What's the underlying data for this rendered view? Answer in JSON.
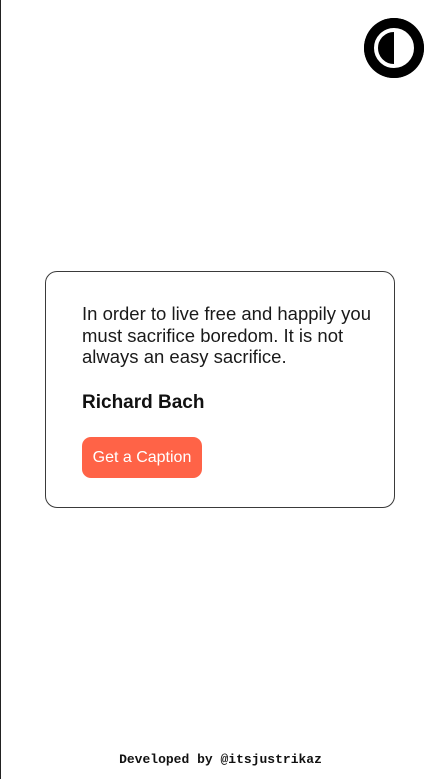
{
  "theme_toggle": {
    "icon": "contrast-icon",
    "color": "#000000"
  },
  "quote_card": {
    "text": "In order to live free and happily you must sacrifice boredom. It is not always an easy sacrifice.",
    "author": "Richard Bach",
    "button_label": "Get a Caption",
    "button_color": "#ff6347"
  },
  "footer": {
    "credit": "Developed by @itsjustrikaz"
  }
}
